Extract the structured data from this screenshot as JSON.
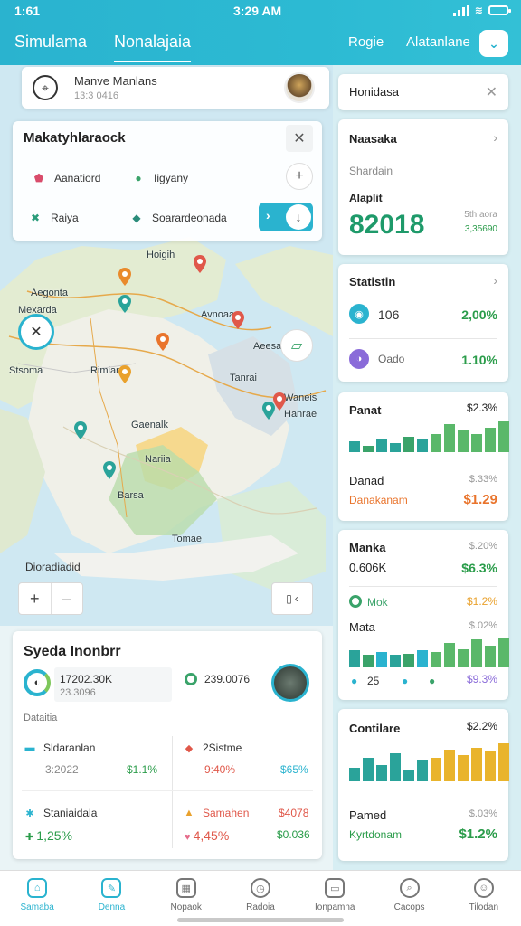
{
  "status": {
    "time_left": "1:61",
    "time_center": "3:29 AM"
  },
  "header": {
    "tabs": [
      {
        "label": "Simulama"
      },
      {
        "label": "Nonalajaia"
      }
    ],
    "right_links": [
      {
        "label": "Rogie"
      },
      {
        "label": "Alatanlane"
      }
    ],
    "download_icon": "chevron-down-icon"
  },
  "location": {
    "name": "Manve Manlans",
    "sub": "13:3 0416"
  },
  "filter": {
    "title": "Makatyhlaraock",
    "chips": [
      {
        "label": "Aanatiord",
        "icon": "shield-icon",
        "color": "#d94c6b"
      },
      {
        "label": "Iigyany",
        "icon": "leaf-icon",
        "color": "#3aa36a"
      },
      {
        "label": "Raiya",
        "icon": "route-icon",
        "color": "#2a9c7a"
      },
      {
        "label": "Soarardeonada",
        "icon": "drop-icon",
        "color": "#2a8c7a"
      }
    ]
  },
  "map": {
    "labels": [
      {
        "text": "Hoigih"
      },
      {
        "text": "Aegonta"
      },
      {
        "text": "Mexarda"
      },
      {
        "text": "Avnoaa"
      },
      {
        "text": "Stsoma"
      },
      {
        "text": "Rimian"
      },
      {
        "text": "Gaenalk"
      },
      {
        "text": "Nariia"
      },
      {
        "text": "Aeesal"
      },
      {
        "text": "Tanrai"
      },
      {
        "text": "Waneis"
      },
      {
        "text": "Hanrae"
      },
      {
        "text": "Barsa"
      },
      {
        "text": "Tomae"
      }
    ],
    "footer_label": "Dioradiadid"
  },
  "summary": {
    "title": "Syeda Inonbrr",
    "value_main": "17202.30K",
    "value_sub": "23.3096",
    "value_right": "239.0076",
    "section_label": "Dataitia",
    "rows": [
      {
        "label": "Sldaranlan",
        "sub": "3:2022",
        "value": "$1.1%",
        "value_color": "#2a9c4a"
      },
      {
        "label": "2Sistme",
        "sub": "9:40%",
        "value": "$65%",
        "value_color": "#2ab3cf"
      },
      {
        "label": "Staniaidala",
        "sub": "1,25%",
        "value": "",
        "value_color": "#2a9c4a"
      },
      {
        "label": "Samahen",
        "sub": "4,45%",
        "value": "$4078",
        "value_color": "#e0584a"
      },
      {
        "label": "",
        "sub": "",
        "value": "$0.036",
        "value_color": "#2a9c4a"
      }
    ]
  },
  "right": {
    "search": "Honidasa",
    "card1": {
      "title": "Naasaka",
      "sub": "Shardain",
      "label": "Alaplit",
      "big": "82018",
      "small1": "5th aora",
      "small2": "3,35690"
    },
    "card2": {
      "title": "Statistin",
      "row1_label": "106",
      "row1_val": "2,00%",
      "row2_label": "Oado",
      "row2_val": "1.10%"
    },
    "card3": {
      "title": "Panat",
      "pct": "$2.3%",
      "label2": "Danad",
      "sub2": "Danakanam",
      "pct2": "$.33%",
      "val2": "$1.29"
    },
    "card4": {
      "title": "Manka",
      "pct": "$.20%",
      "val": "0.606K",
      "val_r": "$6.3%",
      "row_label": "Mok",
      "row_val": "$1.2%",
      "label3": "Mata",
      "pct3": "$.02%",
      "foot1": "25",
      "foot2": "$9.3%"
    },
    "card5": {
      "title": "Contilare",
      "pct": "$2.2%",
      "label2": "Pamed",
      "sub2": "Kyrtdonam",
      "pct2": "$.03%",
      "val2": "$1.2%"
    },
    "bar_series": {
      "card3": [
        0.35,
        0.22,
        0.45,
        0.28,
        0.5,
        0.4,
        0.6,
        0.9,
        0.7,
        0.6,
        0.8,
        1.0
      ],
      "card4": [
        0.55,
        0.4,
        0.5,
        0.4,
        0.45,
        0.55,
        0.5,
        0.8,
        0.6,
        0.9,
        0.7,
        0.95
      ],
      "card5": [
        0.35,
        0.6,
        0.4,
        0.7,
        0.3,
        0.55,
        0.6,
        0.8,
        0.65,
        0.85,
        0.75,
        0.95
      ]
    }
  },
  "tabs": [
    {
      "label": "Samaba",
      "active": true
    },
    {
      "label": "Denna",
      "active": true
    },
    {
      "label": "Nopaok",
      "active": false
    },
    {
      "label": "Radoia",
      "active": false
    },
    {
      "label": "Ionpamna",
      "active": false
    },
    {
      "label": "Cacops",
      "active": false
    },
    {
      "label": "Tilodan",
      "active": false
    }
  ]
}
